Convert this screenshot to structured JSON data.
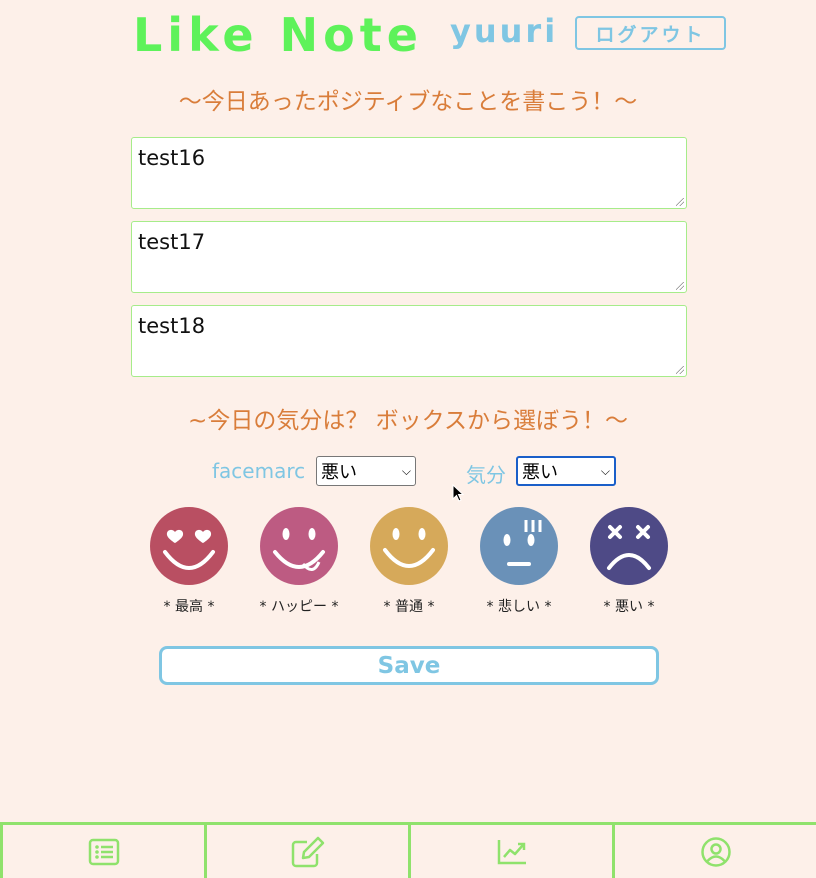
{
  "header": {
    "title": "Like Note",
    "username": "yuuri",
    "logout_label": "ログアウト"
  },
  "positive": {
    "heading": "〜今日あったポジティブなことを書こう！〜",
    "entries": [
      "test16",
      "test17",
      "test18"
    ]
  },
  "mood": {
    "heading": "~今日の気分は？ ボックスから選ぼう！〜",
    "facemarc_label": "facemarc",
    "facemarc_value": "悪い",
    "kibun_label": "気分",
    "kibun_value": "悪い"
  },
  "faces": [
    {
      "label": "* 最高 *",
      "icon": "heart-eyes-face-icon",
      "color": "#b94f62"
    },
    {
      "label": "* ハッピー *",
      "icon": "yummy-face-icon",
      "color": "#bd5b82"
    },
    {
      "label": "* 普通 *",
      "icon": "smile-face-icon",
      "color": "#d6a95a"
    },
    {
      "label": "* 悲しい *",
      "icon": "worried-face-icon",
      "color": "#6a91b8"
    },
    {
      "label": "* 悪い *",
      "icon": "dizzy-face-icon",
      "color": "#4e4a86"
    }
  ],
  "save_label": "Save",
  "nav": [
    {
      "icon": "list-icon"
    },
    {
      "icon": "edit-icon"
    },
    {
      "icon": "chart-icon"
    },
    {
      "icon": "user-icon"
    }
  ],
  "colors": {
    "background": "#fdf0e9",
    "title_green": "#5ef25a",
    "accent_blue": "#7fc6e3",
    "heading_orange": "#d97d3a",
    "nav_green": "#8fe26c"
  }
}
